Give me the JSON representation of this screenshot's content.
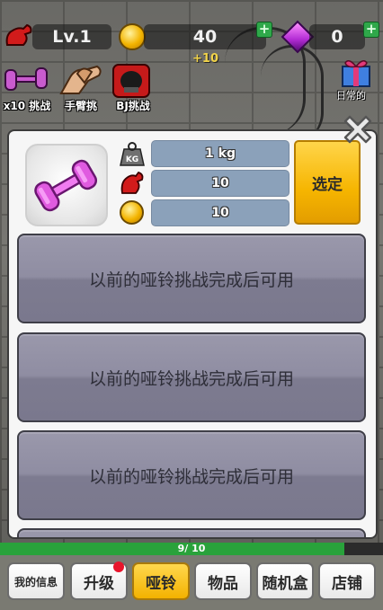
{
  "status_bar": {
    "level": "Lv.1",
    "coins": "40",
    "coin_bonus": "+10",
    "gems": "0"
  },
  "challenges": [
    {
      "label": "x10 挑战",
      "icon": "dumbbell-icon"
    },
    {
      "label": "手臂挑",
      "icon": "armwrestle-icon"
    },
    {
      "label": "BJ挑战",
      "icon": "boxing-glove-icon"
    }
  ],
  "daily_label": "日常的",
  "item": {
    "weight": "1 kg",
    "strength": "10",
    "cost": "10",
    "select_label": "选定"
  },
  "locked_slots": [
    {
      "text": "以前的哑铃挑战完成后可用"
    },
    {
      "text": "以前的哑铃挑战完成后可用"
    },
    {
      "text": "以前的哑铃挑战完成后可用"
    }
  ],
  "progress": {
    "text": "9/ 10",
    "fraction": 0.9
  },
  "nav": {
    "my_info": "我的信息",
    "upgrade": "升级",
    "dumbbell": "哑铃",
    "items": "物品",
    "random_box": "随机盒",
    "shop": "店铺"
  },
  "colors": {
    "accent": "#f6b500",
    "bar": "#8ba1ba",
    "progress": "#29a23b"
  }
}
